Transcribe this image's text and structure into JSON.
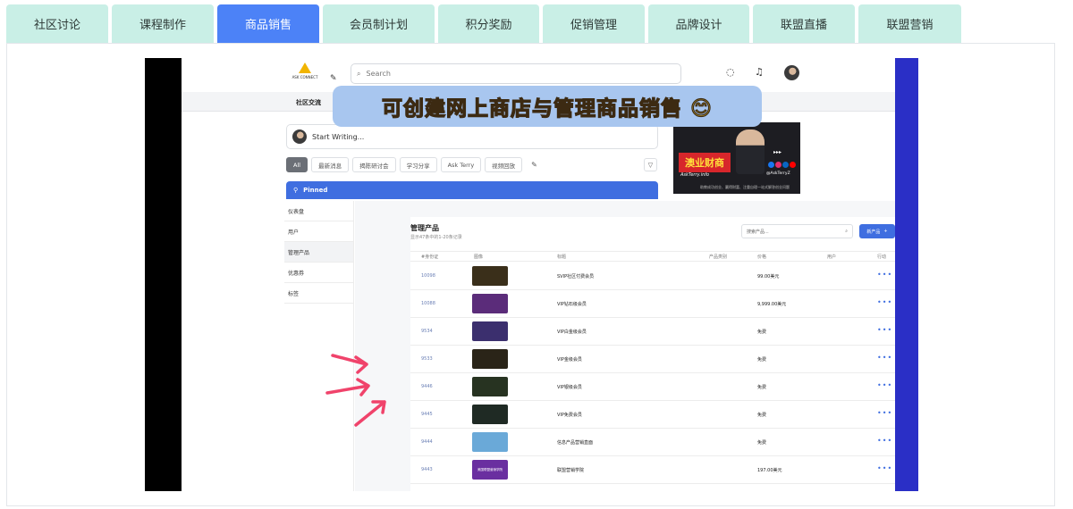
{
  "tabs": [
    {
      "label": "社区讨论",
      "active": false
    },
    {
      "label": "课程制作",
      "active": false
    },
    {
      "label": "商品销售",
      "active": true
    },
    {
      "label": "会员制计划",
      "active": false
    },
    {
      "label": "积分奖励",
      "active": false
    },
    {
      "label": "促销管理",
      "active": false
    },
    {
      "label": "品牌设计",
      "active": false
    },
    {
      "label": "联盟直播",
      "active": false
    },
    {
      "label": "联盟营销",
      "active": false
    }
  ],
  "app": {
    "logo_text": "ASK CONNECT",
    "search_placeholder": "Search",
    "section_label": "社区交流",
    "compose_placeholder": "Start Writing...",
    "filters": [
      "All",
      "最新消息",
      "揭陈研讨会",
      "学习分享",
      "Ask Terry",
      "视频回放"
    ],
    "pinned_label": "Pinned",
    "overlay_caption": "可创建网上商店与管理商品销售 😊"
  },
  "promo": {
    "title": "澳业财商",
    "handle": "AskTerry.info",
    "tag": "@AskTerryZ",
    "note": "助教成功创业、赢得财富、注重自理一站式解答创业问题"
  },
  "admin": {
    "nav": [
      "仪表盘",
      "用户",
      "管理产品",
      "优惠券",
      "标签"
    ],
    "active_nav": "管理产品",
    "title": "管理产品",
    "subtitle": "显示47条中的1-20条记录",
    "search_placeholder": "搜索产品...",
    "new_button": "新产品",
    "columns": [
      "#身份证",
      "图像",
      "标题",
      "产品类别",
      "价格",
      "用户",
      "行动"
    ],
    "rows": [
      {
        "id": "10098",
        "title": "SVIP社区付费会员",
        "price": "99.00美元",
        "thumb_color": "#3a2f1a",
        "thumb_text": ""
      },
      {
        "id": "10088",
        "title": "VIP钻石级会员",
        "price": "9,999.00美元",
        "thumb_color": "#5b2c7a",
        "thumb_text": ""
      },
      {
        "id": "9534",
        "title": "VIP白金级会员",
        "price": "免费",
        "thumb_color": "#3b2f6e",
        "thumb_text": ""
      },
      {
        "id": "9533",
        "title": "VIP金级会员",
        "price": "免费",
        "thumb_color": "#2a2418",
        "thumb_text": ""
      },
      {
        "id": "9446",
        "title": "VIP银级会员",
        "price": "免费",
        "thumb_color": "#273321",
        "thumb_text": ""
      },
      {
        "id": "9445",
        "title": "VIP免费会员",
        "price": "免费",
        "thumb_color": "#1f2a24",
        "thumb_text": ""
      },
      {
        "id": "9444",
        "title": "信息产品营销直面",
        "price": "免费",
        "thumb_color": "#6aa9d8",
        "thumb_text": ""
      },
      {
        "id": "9443",
        "title": "联盟营销学院",
        "price": "197.00美元",
        "thumb_color": "#6a2fa0",
        "thumb_text": "美国联盟营销学院"
      }
    ]
  },
  "colors": {
    "tab_bg": "#c9efe6",
    "tab_active": "#4c82f7",
    "accent": "#3f6ee0",
    "video_right_bar": "#2a2fc6",
    "annotation": "#f0436b"
  }
}
